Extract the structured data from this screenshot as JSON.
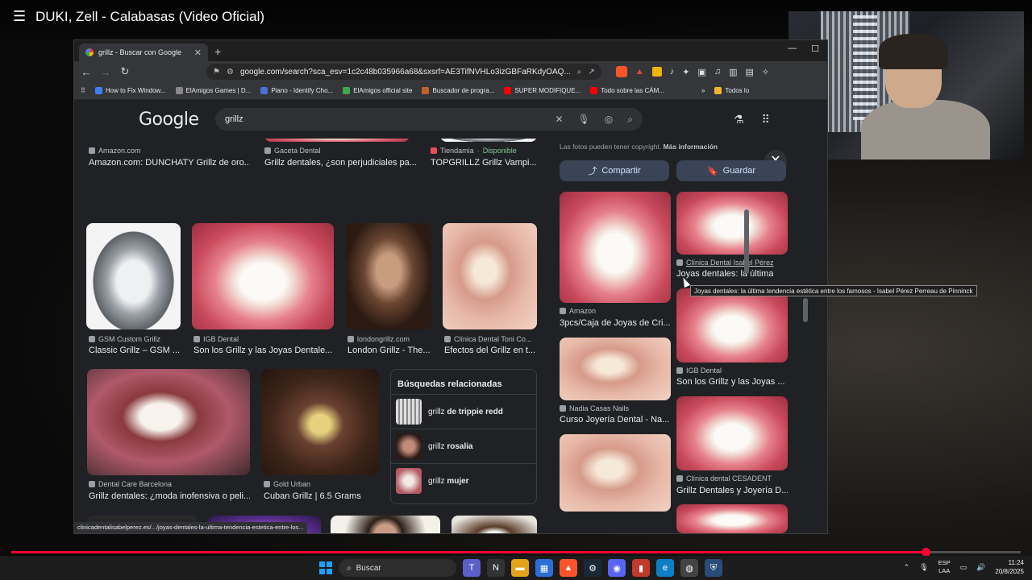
{
  "video": {
    "title": "DUKI, Zell - Calabasas (Video Oficial)",
    "progress_fraction": 0.906
  },
  "browser": {
    "tab_title": "grillz - Buscar con Google",
    "url": "google.com/search?sca_esv=1c2c48b035966a68&sxsrf=AE3TifNVHLo3izGBFaRKdyOAQ...",
    "bookmarks": [
      "How to Fix Window...",
      "ElAmigos Games | D...",
      "Piano - Identify Cho...",
      "ElAmigos official site",
      "Buscador de progra...",
      "SUPER MODIFIQUE...",
      "Todo sobre las CÁM...",
      "Todos lo"
    ]
  },
  "google": {
    "logo": "Google",
    "query": "grillz"
  },
  "results": [
    {
      "source": "Amazon.com",
      "caption": "Amazon.com: DUNCHATY Grillz de oro..."
    },
    {
      "source": "Gaceta Dental",
      "caption": "Grillz dentales, ¿son perjudiciales pa..."
    },
    {
      "source": "Tiendamia",
      "badge": "Disponible",
      "caption": "TOPGRILLZ Grillz Vampi..."
    },
    {
      "source": "GSM Custom Grillz",
      "caption": "Classic Grillz – GSM ..."
    },
    {
      "source": "IGB Dental",
      "caption": "Son los Grillz y las Joyas Dentale..."
    },
    {
      "source": "londongrillz.com",
      "caption": "London Grillz - The..."
    },
    {
      "source": "Clínica Dental Toni Co...",
      "caption": "Efectos del Grillz en t..."
    },
    {
      "source": "Dental Care Barcelona",
      "caption": "Grillz dentales: ¿moda inofensiva o peli..."
    },
    {
      "source": "Gold Urban",
      "caption": "Cuban Grillz | 6.5 Grams"
    }
  ],
  "related": {
    "title": "Búsquedas relacionadas",
    "items": [
      {
        "prefix": "grillz",
        "bold": "de trippie redd"
      },
      {
        "prefix": "grillz",
        "bold": "rosalia"
      },
      {
        "prefix": "grillz",
        "bold": "mujer"
      }
    ]
  },
  "status_url": "clinicadentalisabelperez.es/.../joyas-dentales-la-ultima-tendencia-estetica-entre-los...",
  "panel": {
    "copyright": "Las fotos pueden tener copyright.",
    "more_info": "Más información",
    "share": "Compartir",
    "save": "Guardar",
    "items": [
      {
        "source": "Amazon",
        "caption": "3pcs/Caja de Joyas de Cri..."
      },
      {
        "source": "Clínica Dental Isabel Pérez",
        "caption": "Joyas dentales: la última t..."
      },
      {
        "source": "IGB Dental",
        "caption": "Son los Grillz y las Joyas ..."
      },
      {
        "source": "Nadia Casas Nails",
        "caption": "Curso Joyería Dental - Na..."
      },
      {
        "source": "Clínica dental CESADENT",
        "caption": "Grillz Dentales y Joyería D..."
      }
    ]
  },
  "tooltip": "Joyas dentales: la última tendencia estética entre los famosos - Isabel  Pérez Perreau de Pinninck",
  "taskbar": {
    "search": "Buscar",
    "lang1": "ESP",
    "lang2": "LAA",
    "time": "11:24",
    "date": "20/8/2025"
  }
}
